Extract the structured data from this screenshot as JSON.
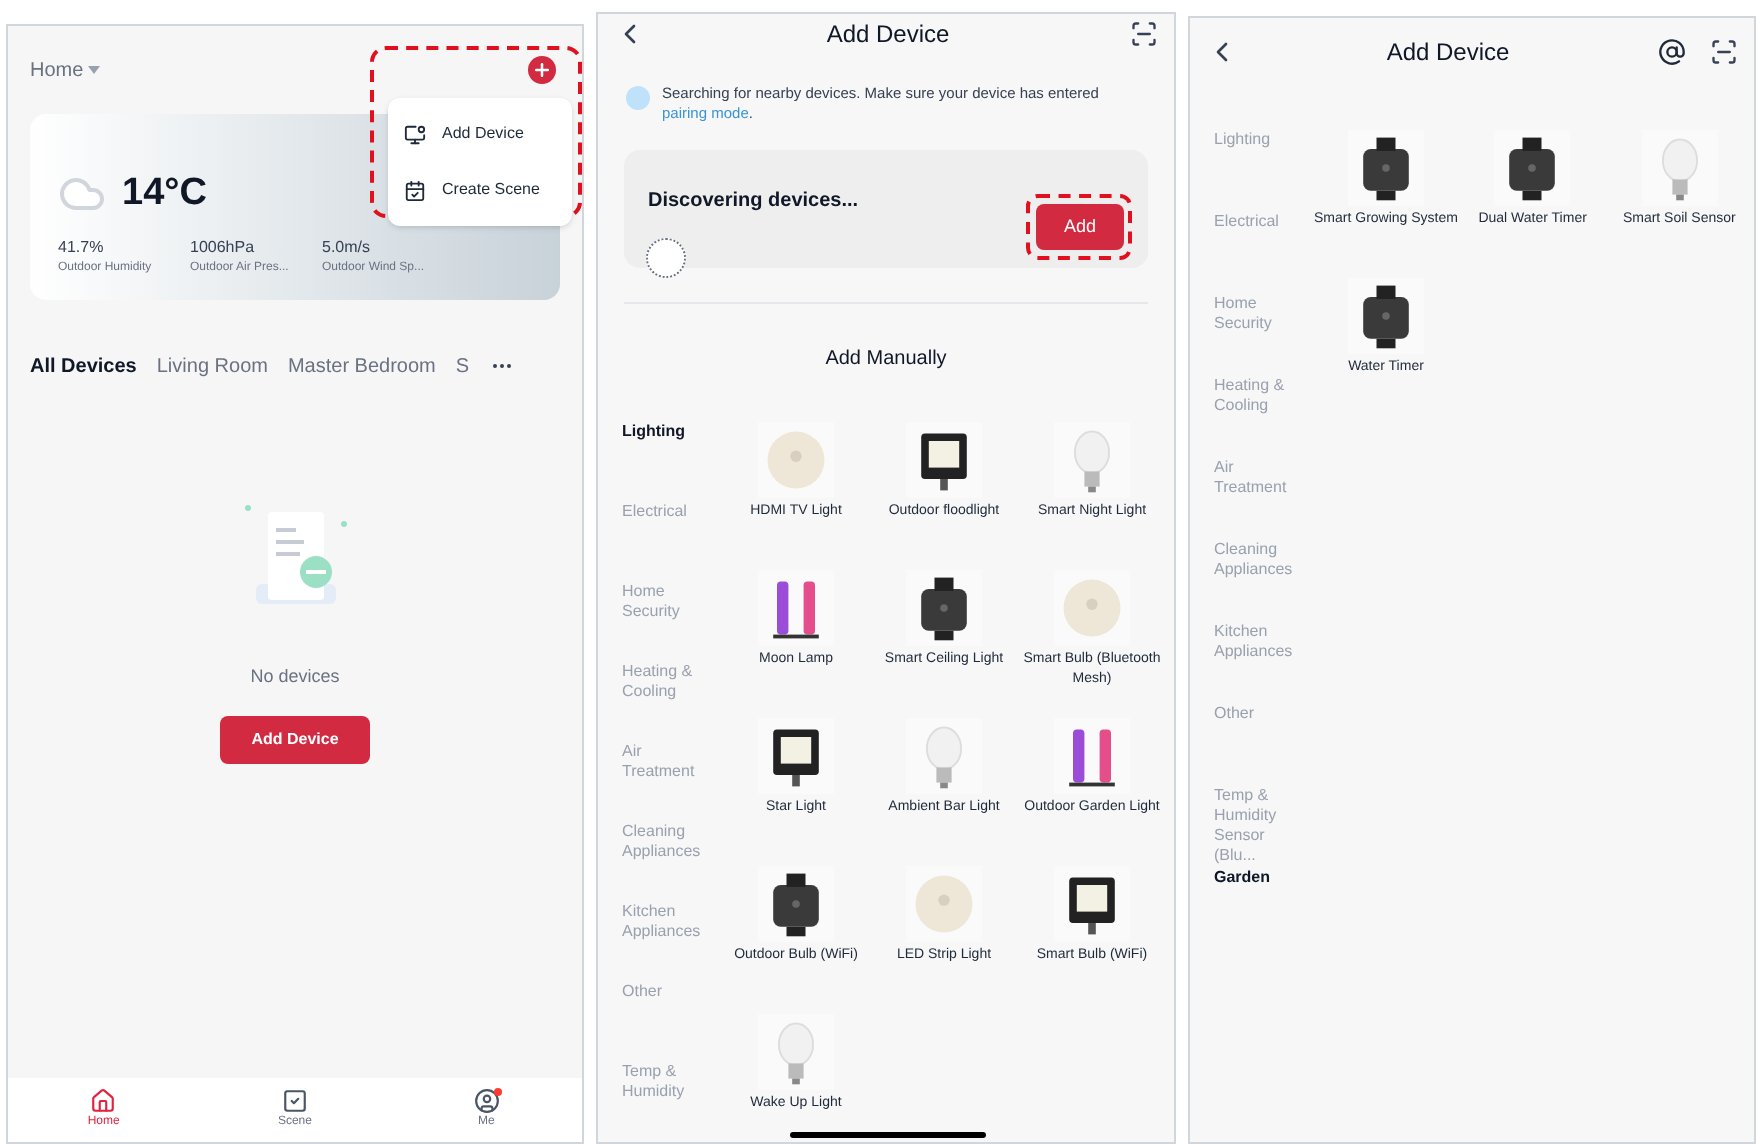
{
  "home": {
    "home_selector": "Home",
    "menu_highlighted": true,
    "menu": [
      {
        "kind": "device",
        "label": "Add Device"
      },
      {
        "kind": "scene",
        "label": "Create Scene"
      }
    ],
    "weather": {
      "temperature": "14°C",
      "stats": [
        {
          "value": "41.7%",
          "label": "Outdoor Humidity"
        },
        {
          "value": "1006hPa",
          "label": "Outdoor Air Pres..."
        },
        {
          "value": "5.0m/s",
          "label": "Outdoor Wind Sp..."
        }
      ]
    },
    "room_tabs": [
      {
        "label": "All Devices",
        "selected": true
      },
      {
        "label": "Living Room",
        "selected": false
      },
      {
        "label": "Master Bedroom",
        "selected": false
      },
      {
        "label": "S",
        "selected": false
      }
    ],
    "empty_text": "No devices",
    "add_button": "Add Device",
    "nav": [
      {
        "kind": "home",
        "label": "Home",
        "selected": true,
        "badge": false
      },
      {
        "kind": "scene",
        "label": "Scene",
        "selected": false,
        "badge": false
      },
      {
        "kind": "me",
        "label": "Me",
        "selected": false,
        "badge": true
      }
    ]
  },
  "add_device": {
    "title": "Add Device",
    "notice": "Searching for nearby devices. Make sure your device has entered ",
    "notice_link": "pairing mode",
    "notice_end": ".",
    "discovering": "Discovering devices...",
    "add_button": "Add",
    "add_highlighted": true,
    "section_title": "Add Manually",
    "categories": [
      {
        "label": "Lighting",
        "selected": true
      },
      {
        "label": "Electrical",
        "selected": false
      },
      {
        "label": "Home Security",
        "selected": false
      },
      {
        "label": "Heating & Cooling",
        "selected": false
      },
      {
        "label": "Air Treatment",
        "selected": false
      },
      {
        "label": "Cleaning Appliances",
        "selected": false
      },
      {
        "label": "Kitchen Appliances",
        "selected": false
      },
      {
        "label": "Other",
        "selected": false
      },
      {
        "label": "Temp & Humidity",
        "selected": false
      }
    ],
    "devices": [
      "HDMI TV Light",
      "Outdoor floodlight",
      "Smart Night Light",
      "Moon Lamp",
      "Smart Ceiling Light",
      "Smart Bulb (Bluetooth Mesh)",
      "Star Light",
      "Ambient Bar Light",
      "Outdoor Garden Light",
      "Outdoor Bulb (WiFi)",
      "LED Strip Light",
      "Smart Bulb (WiFi)",
      "Wake Up Light"
    ]
  },
  "garden": {
    "title": "Add Device",
    "categories": [
      {
        "label": "Lighting",
        "selected": false
      },
      {
        "label": "Electrical",
        "selected": false
      },
      {
        "label": "Home Security",
        "selected": false
      },
      {
        "label": "Heating & Cooling",
        "selected": false
      },
      {
        "label": "Air Treatment",
        "selected": false
      },
      {
        "label": "Cleaning Appliances",
        "selected": false
      },
      {
        "label": "Kitchen Appliances",
        "selected": false
      },
      {
        "label": "Other",
        "selected": false
      },
      {
        "label": "Temp & Humidity Sensor (Blu...",
        "selected": false
      },
      {
        "label": "Garden",
        "selected": true
      }
    ],
    "devices": [
      "Smart Growing System",
      "Dual Water Timer",
      "Smart Soil Sensor",
      "Water Timer"
    ]
  }
}
